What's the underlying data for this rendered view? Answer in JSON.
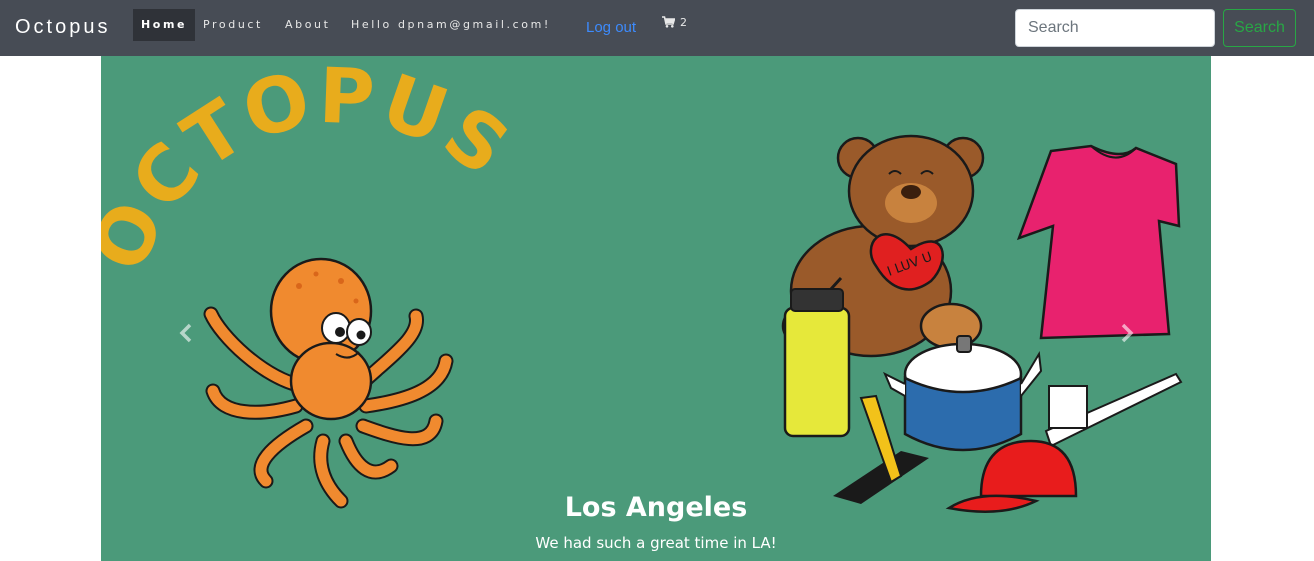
{
  "navbar": {
    "brand": "Octopus",
    "links": [
      "Home",
      "Product",
      "About",
      "Hello dpnam@gmail.com!"
    ],
    "logout": "Log out",
    "cart_count": "2",
    "cart_icon": "shopping-cart-icon"
  },
  "search": {
    "placeholder": "Search",
    "button": "Search"
  },
  "carousel": {
    "logo_text": "OCTOPUS",
    "heart_text": "I LUV U",
    "caption_title": "Los Angeles",
    "caption_text": "We had such a great time in LA!",
    "prev_icon": "chevron-left-icon",
    "next_icon": "chevron-right-icon"
  },
  "colors": {
    "navbar_bg": "#474c55",
    "carousel_bg": "#4b9a7a",
    "logout_link": "#3d8bfd",
    "search_button": "#28a745",
    "logo_text": "#e8ac1c",
    "octopus": "#f08a2f"
  }
}
